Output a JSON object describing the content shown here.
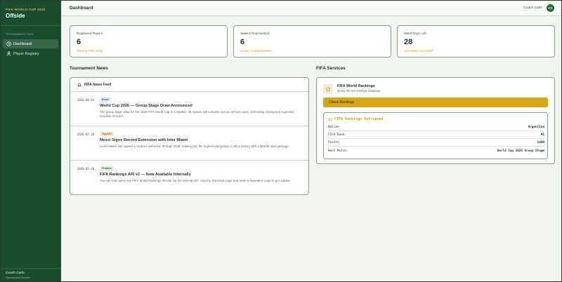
{
  "sidebar": {
    "brand_sub": "FIFA WORLD CUP 2026",
    "brand_title": "Offside",
    "section": "TOURNAMENT HUB",
    "items": [
      {
        "label": "Dashboard",
        "icon": "dashboard-icon",
        "active": true
      },
      {
        "label": "Player Registry",
        "icon": "user-icon",
        "active": false
      }
    ],
    "user_name": "Coach Carlo",
    "user_role": "Tournament Director"
  },
  "header": {
    "title": "Dashboard",
    "user": "Coach Carlo",
    "avatar": "CC"
  },
  "stats": [
    {
      "label": "Registered Players",
      "value": "6",
      "note": "Top 6 by FIFA rating"
    },
    {
      "label": "Nations Represented",
      "value": "6",
      "note": "across 4 confederations"
    },
    {
      "label": "Match Days Left",
      "value": "28",
      "note": "until World Cup kickoff"
    }
  ],
  "news": {
    "section_title": "Tournament News",
    "feed_title": "FIFA News Feed",
    "items": [
      {
        "date": "2026-06-01",
        "badge": "Event",
        "title": "World Cup 2026 — Group Stage Draw Announced",
        "body": "The group stage draw for the 2026 FIFA World Cup is complete. 48 nations will compete across 16 host cities. Defending champions Argentina headline Group A."
      },
      {
        "date": "2026-05-28",
        "badge": "Transfer",
        "title": "Messi Signs Record Extension with Inter Miami",
        "body": "Lionel Messi has signed a contract extension through 2028, making him the highest-paid player in MLS history with a $150M total package."
      },
      {
        "date": "2026-05-20",
        "badge": "Product",
        "title": "FIFA Rankings API v2 — Now Available Internally",
        "body": "You can now query live FIFA World Rankings directly via the internal API. Visit the Rankings page and enter a federation code to get started."
      }
    ]
  },
  "services": {
    "section_title": "FIFA Services",
    "name": "FIFA World Rankings",
    "desc": "Query the live rankings database",
    "button": "Check Rankings",
    "result_title": "FIFA Rankings Retrieved",
    "rows": [
      {
        "label": "Nation:",
        "value": "Argentina"
      },
      {
        "label": "FIFA Rank:",
        "value": "#1"
      },
      {
        "label": "Points:",
        "value": "1889"
      },
      {
        "label": "Next Match:",
        "value": "World Cup 2026 Group Stage"
      }
    ]
  },
  "colors": {
    "sidebar": "#1a4d2e",
    "accent_gold": "#d4a61a",
    "border_green": "#7ea58a",
    "badge_event": "#dbe6f7",
    "badge_transfer": "#f8e7c2",
    "badge_product": "#d9efd9"
  }
}
